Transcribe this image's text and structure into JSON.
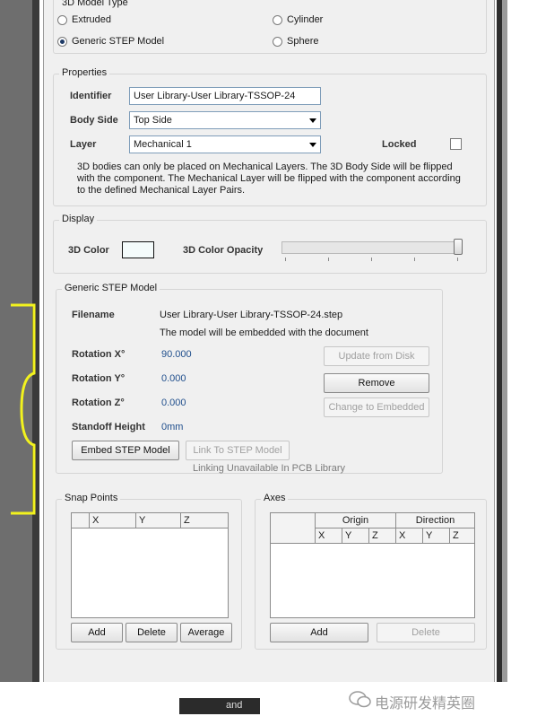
{
  "model_type": {
    "title": "3D Model Type",
    "options": [
      {
        "label": "Extruded",
        "selected": false
      },
      {
        "label": "Cylinder",
        "selected": false
      },
      {
        "label": "Generic STEP Model",
        "selected": true
      },
      {
        "label": "Sphere",
        "selected": false
      }
    ]
  },
  "properties": {
    "title": "Properties",
    "identifier_label": "Identifier",
    "identifier_value": "User Library-User Library-TSSOP-24",
    "body_side_label": "Body Side",
    "body_side_value": "Top Side",
    "layer_label": "Layer",
    "layer_value": "Mechanical 1",
    "locked_label": "Locked",
    "locked_checked": false,
    "note": "3D bodies can only be placed on Mechanical Layers. The 3D Body Side will be flipped with the component. The Mechanical Layer will be flipped with the component according to the defined Mechanical Layer Pairs."
  },
  "display": {
    "title": "Display",
    "color_label": "3D Color",
    "color_swatch": "#f4fbfb",
    "opacity_label": "3D Color Opacity",
    "opacity_level": 1.0
  },
  "step": {
    "title": "Generic STEP Model",
    "filename_label": "Filename",
    "filename_value": "User Library-User Library-TSSOP-24.step",
    "embedded_note": "The model will be embedded with the document",
    "rot_x_label": "Rotation X°",
    "rot_x_value": "90.000",
    "rot_y_label": "Rotation Y°",
    "rot_y_value": "0.000",
    "rot_z_label": "Rotation Z°",
    "rot_z_value": "0.000",
    "standoff_label": "Standoff Height",
    "standoff_value": "0mm",
    "update_btn": "Update from Disk",
    "remove_btn": "Remove",
    "change_btn": "Change to Embedded",
    "embed_btn": "Embed STEP Model",
    "link_btn": "Link To STEP Model",
    "link_note": "Linking Unavailable In PCB Library"
  },
  "snap_points": {
    "title": "Snap Points",
    "columns": [
      "",
      "X",
      "Y",
      "Z"
    ],
    "add_btn": "Add",
    "delete_btn": "Delete",
    "average_btn": "Average"
  },
  "axes": {
    "title": "Axes",
    "group_headers": [
      "Origin",
      "Direction"
    ],
    "columns": [
      "X",
      "Y",
      "Z",
      "X",
      "Y",
      "Z"
    ],
    "add_btn": "Add",
    "delete_btn": "Delete"
  },
  "status_fragment": "and",
  "watermark": "电源研发精英圈",
  "colors": {
    "dialog_bg": "#f0f0f0",
    "value_blue": "#1f4e8c",
    "highlight_yellow": "#f2f21e"
  }
}
